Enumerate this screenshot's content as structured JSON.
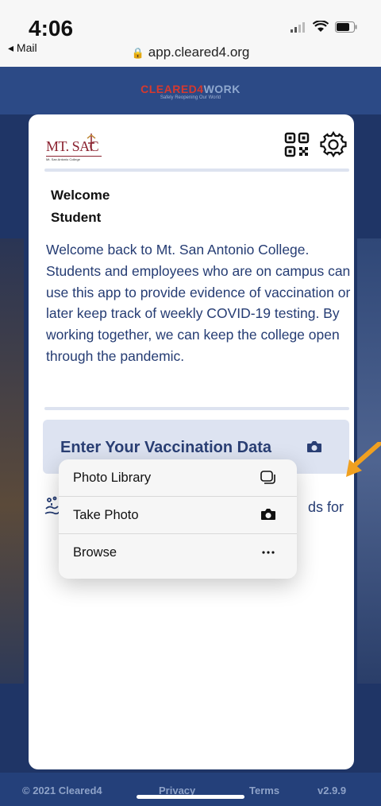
{
  "status": {
    "time": "4:06",
    "back_app": "◂ Mail",
    "url": "app.cleared4.org"
  },
  "brand": {
    "part1": "CLEARED4",
    "part2": "WORK",
    "tagline": "Safely Reopening Our World"
  },
  "logo": {
    "text": "MT. SAC",
    "sub": "Mt. San Antonio College"
  },
  "welcome": {
    "line1": "Welcome",
    "line2": "Student"
  },
  "intro": "Welcome back to Mt. San Antonio College. Students and employees who are on campus can use this app to provide evidence of vaccination or later keep track of weekly COVID-19 testing. By working together, we can keep the college open through the pandemic.",
  "vaccination_button": {
    "label": "Enter Your Vaccination Data",
    "icon": "camera-icon"
  },
  "second_row": {
    "partial_text": "ds for",
    "icon": "hand-wash-icon"
  },
  "popup_menu": {
    "items": [
      {
        "label": "Photo Library",
        "icon": "photo-library-icon"
      },
      {
        "label": "Take Photo",
        "icon": "camera-icon"
      },
      {
        "label": "Browse",
        "icon": "ellipsis-icon"
      }
    ]
  },
  "footer": {
    "copyright": "© 2021 Cleared4",
    "privacy": "Privacy",
    "terms": "Terms",
    "version": "v2.9.9"
  },
  "colors": {
    "primary_blue": "#2c4a86",
    "text_blue": "#253c73",
    "button_bg": "#dde3f1",
    "brand_red": "#d6392e",
    "arrow_orange": "#f0a020",
    "logo_maroon": "#8b2230"
  }
}
